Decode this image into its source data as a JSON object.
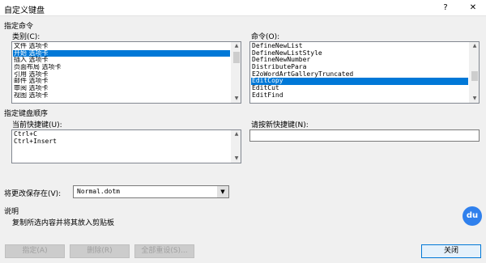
{
  "window": {
    "title": "自定义键盘",
    "help_glyph": "?",
    "close_glyph": "✕"
  },
  "specify_command": {
    "section_label": "指定命令",
    "categories_label": "类别(C):",
    "categories": [
      {
        "label": "文件 选项卡",
        "selected": false
      },
      {
        "label": "开始 选项卡",
        "selected": true
      },
      {
        "label": "插入 选项卡",
        "selected": false
      },
      {
        "label": "页面布局 选项卡",
        "selected": false
      },
      {
        "label": "引用 选项卡",
        "selected": false
      },
      {
        "label": "邮件 选项卡",
        "selected": false
      },
      {
        "label": "审阅 选项卡",
        "selected": false
      },
      {
        "label": "视图 选项卡",
        "selected": false
      }
    ],
    "commands_label": "命令(O):",
    "commands": [
      {
        "label": "DefineNewList",
        "selected": false
      },
      {
        "label": "DefineNewListStyle",
        "selected": false
      },
      {
        "label": "DefineNewNumber",
        "selected": false
      },
      {
        "label": "DistributePara",
        "selected": false
      },
      {
        "label": "E2oWordArtGalleryTruncated",
        "selected": false
      },
      {
        "label": "EditCopy",
        "selected": true
      },
      {
        "label": "EditCut",
        "selected": false
      },
      {
        "label": "EditFind",
        "selected": false
      }
    ]
  },
  "key_sequence": {
    "section_label": "指定键盘顺序",
    "current_keys_label": "当前快捷键(U):",
    "current_keys": [
      "Ctrl+C",
      "Ctrl+Insert"
    ],
    "new_key_label": "请按新快捷键(N):",
    "new_key_value": ""
  },
  "save_in": {
    "label": "将更改保存在(V):",
    "value": "Normal.dotm"
  },
  "description": {
    "section_label": "说明",
    "text": "复制所选内容并将其放入剪贴板"
  },
  "buttons": {
    "assign": "指定(A)",
    "remove": "删除(R)",
    "reset_all": "全部重设(S)...",
    "close": "关闭"
  },
  "watermark": {
    "text": "du"
  }
}
